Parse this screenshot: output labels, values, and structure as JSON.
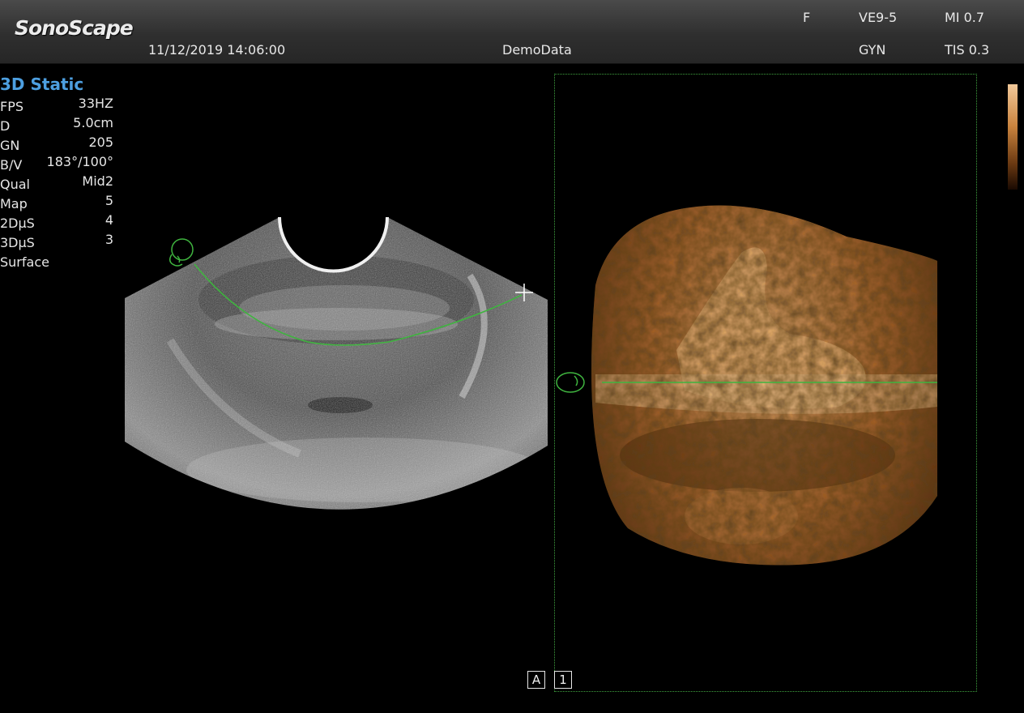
{
  "header": {
    "brand": "SonoScape",
    "datetime": "11/12/2019 14:06:00",
    "patient": "DemoData",
    "preset_flag": "F",
    "probe": "VE9-5",
    "exam": "GYN",
    "mi": "MI 0.7",
    "tis": "TIS 0.3"
  },
  "mode": {
    "title": "3D Static"
  },
  "params": [
    {
      "key": "FPS",
      "value": "33HZ"
    },
    {
      "key": "D",
      "value": "5.0cm"
    },
    {
      "key": "GN",
      "value": "205"
    },
    {
      "key": "B/V",
      "value": "183°/100°"
    },
    {
      "key": "Qual",
      "value": "Mid2"
    },
    {
      "key": "Map",
      "value": "5"
    },
    {
      "key": "2DμS",
      "value": "4"
    },
    {
      "key": "3DμS",
      "value": "3"
    },
    {
      "key": "Surface",
      "value": ""
    }
  ],
  "layout_buttons": {
    "a": "A",
    "one": "1"
  },
  "icons": {
    "orientation_2d": "fetus-head-icon",
    "orientation_3d": "fetus-head-icon",
    "cursor": "crosshair-icon"
  },
  "colors": {
    "accent_blue": "#4d9fe0",
    "trace_green": "#3fb43f",
    "render_sepia": "#c9833e"
  }
}
